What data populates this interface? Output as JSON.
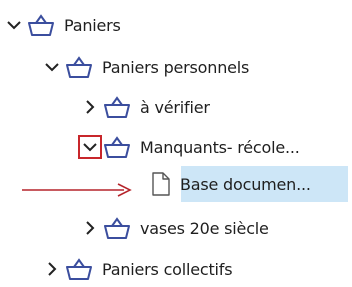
{
  "tree": {
    "root": {
      "label": "Paniers",
      "expanded": true,
      "icon": "basket-icon"
    },
    "personal": {
      "label": "Paniers personnels",
      "expanded": true,
      "icon": "basket-icon"
    },
    "verify": {
      "label": "à vérifier",
      "expanded": false,
      "icon": "basket-icon"
    },
    "missing": {
      "label": "Manquants- récole...",
      "expanded": true,
      "icon": "basket-icon"
    },
    "document": {
      "label": "Base documen...",
      "selected": true,
      "icon": "document-icon"
    },
    "vases": {
      "label": "vases 20e siècle",
      "expanded": false,
      "icon": "basket-icon"
    },
    "collective": {
      "label": "Paniers collectifs",
      "expanded": false,
      "icon": "basket-icon"
    }
  },
  "annotation": {
    "highlight_color": "#c8262b",
    "arrow_color": "#b6242b"
  },
  "colors": {
    "selection": "#cde6f7",
    "icon_stroke": "#3b4e9e"
  }
}
